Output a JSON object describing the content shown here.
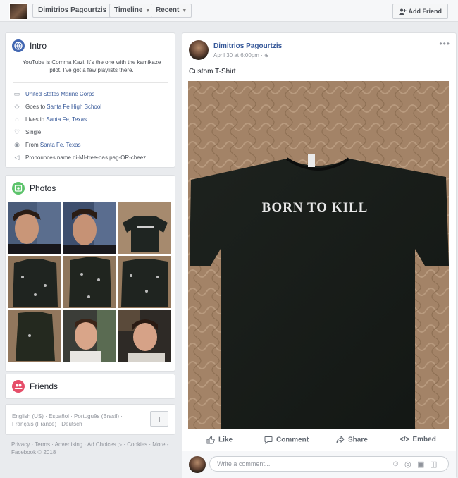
{
  "topbar": {
    "name": "Dimitrios Pagourtzis",
    "timeline_label": "Timeline",
    "recent_label": "Recent",
    "add_friend_label": "Add Friend"
  },
  "intro": {
    "title": "Intro",
    "bio": "YouTube is Comma Kazi. It's the one with the kamikaze pilot. I've got a few playlists there.",
    "rows": [
      {
        "icon": "briefcase-icon",
        "prefix": "",
        "link": "United States Marine Corps"
      },
      {
        "icon": "graduation-cap-icon",
        "prefix": "Goes to ",
        "link": "Santa Fe High School"
      },
      {
        "icon": "home-icon",
        "prefix": "Lives in ",
        "link": "Santa Fe, Texas"
      },
      {
        "icon": "heart-icon",
        "prefix": "Single",
        "link": ""
      },
      {
        "icon": "location-pin-icon",
        "prefix": "From ",
        "link": "Santa Fe, Texas"
      },
      {
        "icon": "speaker-icon",
        "prefix": "Pronounces name di-MI-tree-oas pag-OR-cheez",
        "link": ""
      }
    ]
  },
  "photos": {
    "title": "Photos"
  },
  "friends": {
    "title": "Friends"
  },
  "languages": {
    "text": "English (US) · Español · Português (Brasil) · Français (France) · Deutsch",
    "plus_label": "+"
  },
  "footer": {
    "links": "Privacy · Terms · Advertising · Ad Choices ▷ · Cookies · More -",
    "copyright": "Facebook © 2018"
  },
  "post": {
    "author": "Dimitrios Pagourtzis",
    "timestamp": "April 30 at 6:00pm ·",
    "text": "Custom T-Shirt",
    "shirt_text": "BORN TO KILL",
    "actions": {
      "like": "Like",
      "comment": "Comment",
      "share": "Share",
      "embed": "Embed"
    },
    "comment_placeholder": "Write a comment..."
  },
  "colors": {
    "link": "#365899",
    "background": "#e9ebee",
    "intro_icon": "#4267b2",
    "photos_icon": "#5cc36b",
    "friends_icon": "#e64e69"
  }
}
